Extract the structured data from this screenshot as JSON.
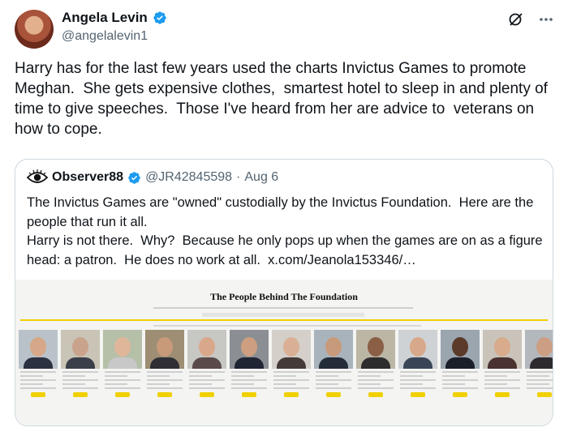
{
  "author": {
    "name": "Angela Levin",
    "handle": "@angelalevin1"
  },
  "icons": {
    "verified": "verified-badge-icon",
    "grok": "grok-icon",
    "more": "more-icon",
    "observer": "eye-logo-icon"
  },
  "tweet": {
    "text": "Harry has for the last few years used the charts Invictus Games to promote Meghan.  She gets expensive clothes,  smartest hotel to sleep in and plenty of time to give speeches.  Those I've heard from her are advice to  veterans on how to cope."
  },
  "quote": {
    "name": "Observer88",
    "handle": "@JR42845598",
    "separator": "·",
    "date": "Aug 6",
    "text": "The Invictus Games are \"owned\" custodially by the Invictus Foundation.  Here are the people that run it all.\nHarry is not there.  Why?  Because he only pops up when the games are on as a figure head: a patron.  He does no work at all.  x.com/Jeanola153346/…"
  },
  "media": {
    "title": "The People Behind The Foundation",
    "people": [
      {
        "bg": "#b9c2c8",
        "skin": "#d6a889",
        "suit": "#2b3140"
      },
      {
        "bg": "#c9c4b5",
        "skin": "#caa38c",
        "suit": "#3a3f4a"
      },
      {
        "bg": "#b6bfa8",
        "skin": "#e0b69a",
        "suit": "#c8c8c8"
      },
      {
        "bg": "#9d8e74",
        "skin": "#c99a7a",
        "suit": "#2f2f35"
      },
      {
        "bg": "#c7c7c4",
        "skin": "#d9a88b",
        "suit": "#5a4a4a"
      },
      {
        "bg": "#8b8f94",
        "skin": "#cd9f80",
        "suit": "#1f2533"
      },
      {
        "bg": "#d4cfc8",
        "skin": "#d9b095",
        "suit": "#443b38"
      },
      {
        "bg": "#a9b3bc",
        "skin": "#c89a7c",
        "suit": "#242c3a"
      },
      {
        "bg": "#bcb6a4",
        "skin": "#8a5f45",
        "suit": "#2d2d2d"
      },
      {
        "bg": "#cfd2d5",
        "skin": "#d7a98a",
        "suit": "#3a4658"
      },
      {
        "bg": "#9aa5ae",
        "skin": "#5b3a2a",
        "suit": "#1a1f2a"
      },
      {
        "bg": "#c9c3ba",
        "skin": "#d7ab8c",
        "suit": "#4a3230"
      },
      {
        "bg": "#b3b8bd",
        "skin": "#cc9f84",
        "suit": "#2e2b2f"
      }
    ]
  }
}
